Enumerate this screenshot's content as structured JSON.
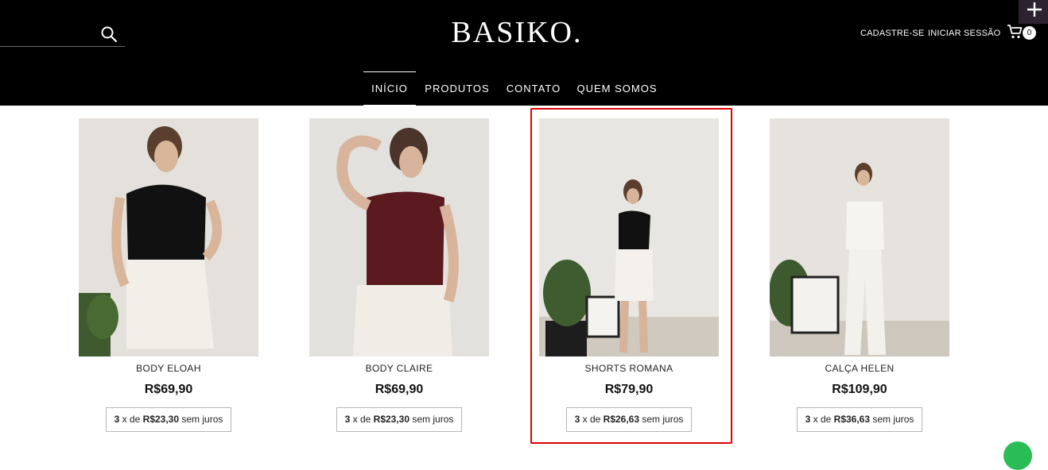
{
  "header": {
    "logo": "BASIKO.",
    "search": {
      "placeholder": "",
      "value": ""
    },
    "account": {
      "register": "CADASTRE-SE",
      "login": "INICIAR SESSÃO"
    },
    "cart": {
      "count": "0"
    }
  },
  "nav": [
    {
      "label": "INÍCIO",
      "active": true
    },
    {
      "label": "PRODUTOS",
      "active": false
    },
    {
      "label": "CONTATO",
      "active": false
    },
    {
      "label": "QUEM SOMOS",
      "active": false
    }
  ],
  "products": [
    {
      "name": "BODY ELOAH",
      "price": "R$69,90",
      "installment": {
        "count": "3",
        "x_de": " x de ",
        "amount": "R$23,30",
        "suffix": " sem juros"
      }
    },
    {
      "name": "BODY CLAIRE",
      "price": "R$69,90",
      "installment": {
        "count": "3",
        "x_de": " x de ",
        "amount": "R$23,30",
        "suffix": " sem juros"
      }
    },
    {
      "name": "SHORTS ROMANA",
      "price": "R$79,90",
      "installment": {
        "count": "3",
        "x_de": " x de ",
        "amount": "R$26,63",
        "suffix": " sem juros"
      }
    },
    {
      "name": "CALÇA HELEN",
      "price": "R$109,90",
      "installment": {
        "count": "3",
        "x_de": " x de ",
        "amount": "R$36,63",
        "suffix": " sem juros"
      }
    }
  ],
  "colors": {
    "header_bg": "#000000",
    "highlight": "#e00000",
    "chat": "#2bbd55"
  }
}
